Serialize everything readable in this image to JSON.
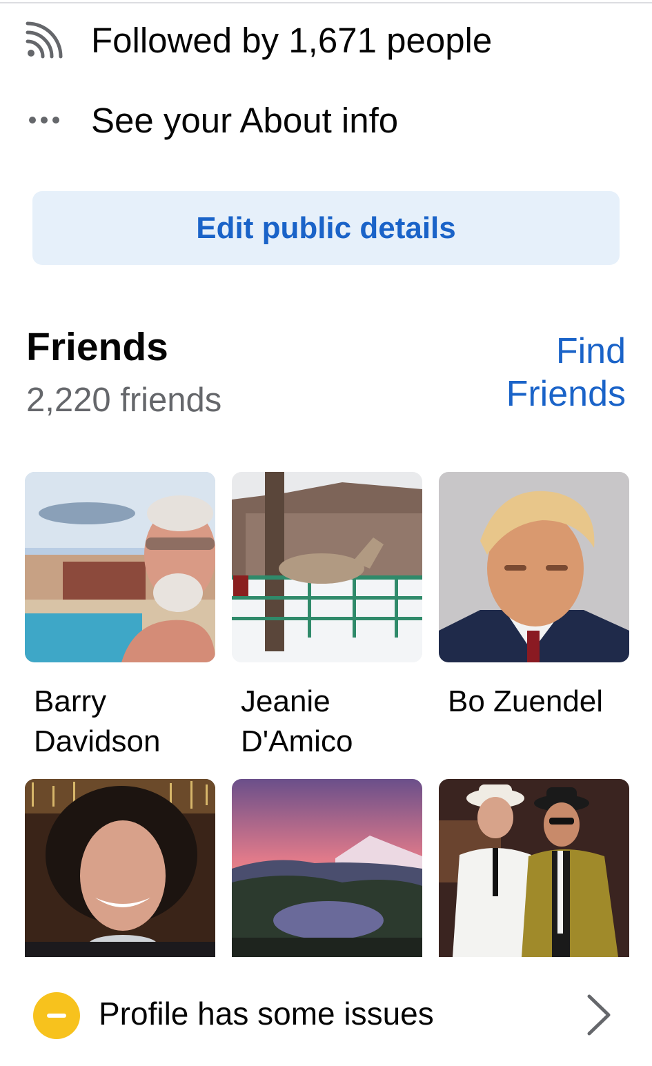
{
  "follow": {
    "icon": "rss-feed-icon",
    "text": "Followed by 1,671 people"
  },
  "about": {
    "icon": "more-dots-icon",
    "text": "See your About info"
  },
  "edit_button": {
    "label": "Edit public details"
  },
  "friends": {
    "title": "Friends",
    "count": "2,220 friends",
    "find_label": "Find Friends",
    "items": [
      {
        "name": "Barry Davidson"
      },
      {
        "name": "Jeanie D'Amico"
      },
      {
        "name": "Bo Zuendel"
      },
      {
        "name": ""
      },
      {
        "name": ""
      },
      {
        "name": ""
      }
    ]
  },
  "issue": {
    "icon": "minus-circle-icon",
    "text": "Profile has some issues",
    "chevron": "chevron-right-icon"
  },
  "colors": {
    "accent": "#1a63c8",
    "button_bg": "#e6f0fa",
    "warning": "#f7c21d",
    "secondary_text": "#65676b"
  }
}
